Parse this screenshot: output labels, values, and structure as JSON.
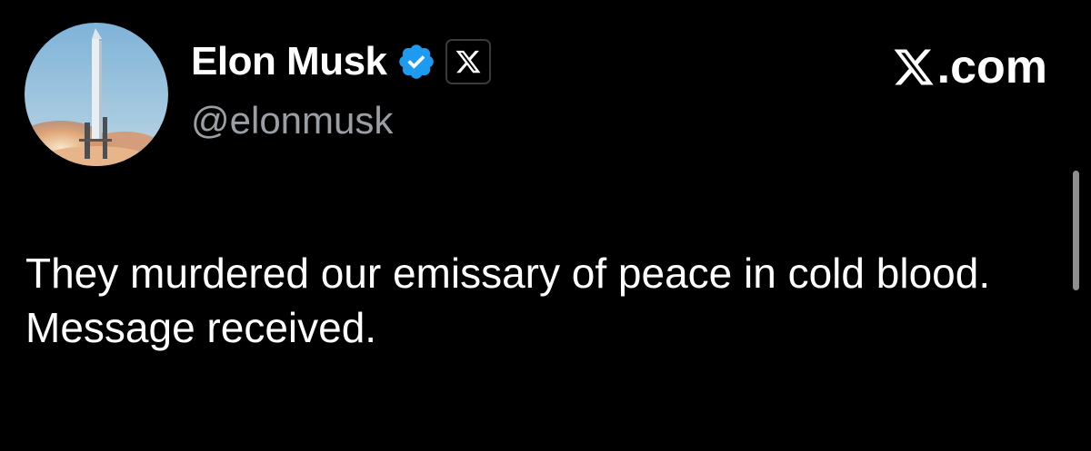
{
  "author": {
    "display_name": "Elon Musk",
    "handle": "@elonmusk",
    "verified_icon": "verified-badge-icon",
    "affiliation_icon": "x-logo-icon"
  },
  "brand": {
    "logo_icon": "x-logo-icon",
    "suffix": ".com"
  },
  "tweet": {
    "text": "They murdered our emissary of peace in cold blood. Message received."
  },
  "colors": {
    "background": "#000000",
    "text": "#ffffff",
    "handle": "#9a9fa4",
    "verified": "#1d9bf0",
    "scrollbar": "#8e8e8e"
  }
}
